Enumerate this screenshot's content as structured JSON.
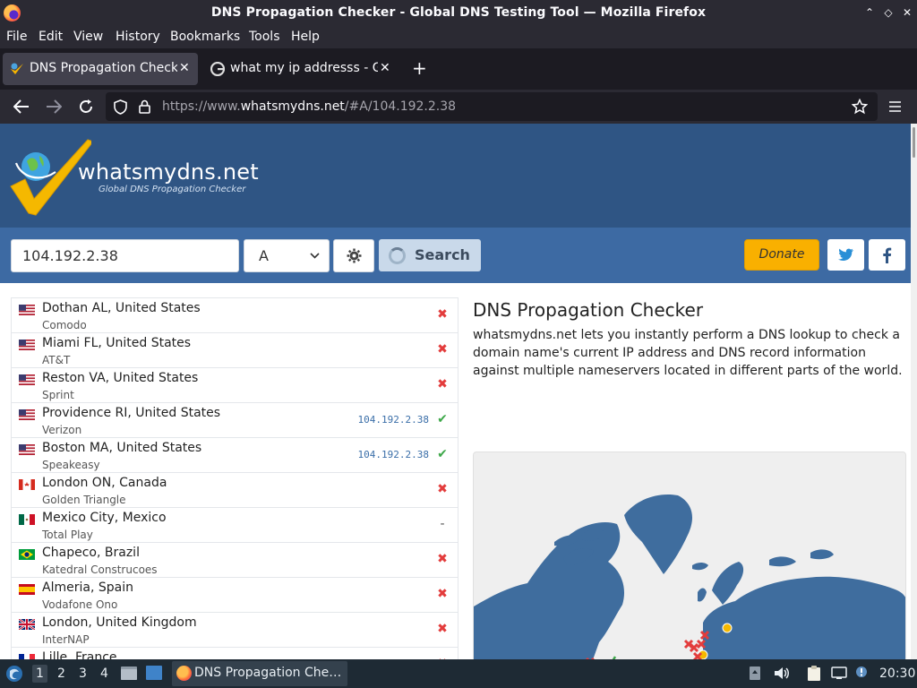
{
  "window": {
    "title": "DNS Propagation Checker - Global DNS Testing Tool — Mozilla Firefox"
  },
  "menu": [
    "File",
    "Edit",
    "View",
    "History",
    "Bookmarks",
    "Tools",
    "Help"
  ],
  "tabs": [
    {
      "label": "DNS Propagation Checker",
      "active": true
    },
    {
      "label": "what my ip addresss - Go",
      "active": false
    }
  ],
  "url": {
    "prefix": "https://www.",
    "domain": "whatsmydns.net",
    "path": "/#A/104.192.2.38"
  },
  "site": {
    "logo_text": "whatsmydns.net",
    "logo_sub": "Global DNS Propagation Checker",
    "search_value": "104.192.2.38",
    "record_type": "A",
    "search_label": "Search",
    "donate_label": "Donate",
    "heading": "DNS Propagation Checker",
    "description": "whatsmydns.net lets you instantly perform a DNS lookup to check a domain name's current IP address and DNS record information against multiple nameservers located in different parts of the world."
  },
  "results": [
    {
      "location": "Dothan AL, United States",
      "provider": "Comodo",
      "flag": "us",
      "ip": "",
      "status": "fail"
    },
    {
      "location": "Miami FL, United States",
      "provider": "AT&T",
      "flag": "us",
      "ip": "",
      "status": "fail"
    },
    {
      "location": "Reston VA, United States",
      "provider": "Sprint",
      "flag": "us",
      "ip": "",
      "status": "fail"
    },
    {
      "location": "Providence RI, United States",
      "provider": "Verizon",
      "flag": "us",
      "ip": "104.192.2.38",
      "status": "ok"
    },
    {
      "location": "Boston MA, United States",
      "provider": "Speakeasy",
      "flag": "us",
      "ip": "104.192.2.38",
      "status": "ok"
    },
    {
      "location": "London ON, Canada",
      "provider": "Golden Triangle",
      "flag": "ca",
      "ip": "",
      "status": "fail"
    },
    {
      "location": "Mexico City, Mexico",
      "provider": "Total Play",
      "flag": "mx",
      "ip": "",
      "status": "none"
    },
    {
      "location": "Chapeco, Brazil",
      "provider": "Katedral Construcoes",
      "flag": "br",
      "ip": "",
      "status": "fail"
    },
    {
      "location": "Almeria, Spain",
      "provider": "Vodafone Ono",
      "flag": "es",
      "ip": "",
      "status": "fail"
    },
    {
      "location": "London, United Kingdom",
      "provider": "InterNAP",
      "flag": "gb",
      "ip": "",
      "status": "fail"
    },
    {
      "location": "Lille, France",
      "provider": "",
      "flag": "fr",
      "ip": "",
      "status": "fail"
    }
  ],
  "taskbar": {
    "workspaces": [
      "1",
      "2",
      "3",
      "4"
    ],
    "task_label": "DNS Propagation Che…",
    "clock": "20:30"
  },
  "colors": {
    "header": "#2f5584",
    "searchbar": "#3d6aa3",
    "donate": "#f9b000",
    "map_land": "#3f6d9e"
  }
}
